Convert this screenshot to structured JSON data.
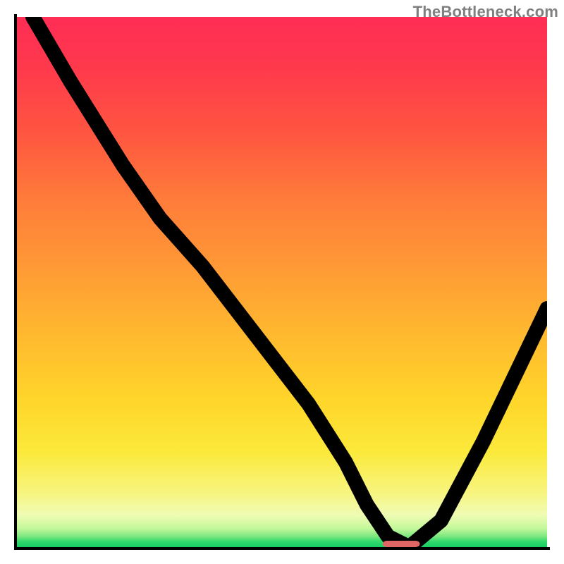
{
  "watermark": "TheBottleneck.com",
  "chart_data": {
    "type": "line",
    "title": "",
    "xlabel": "",
    "ylabel": "",
    "xlim": [
      0,
      100
    ],
    "ylim": [
      0,
      100
    ],
    "grid": false,
    "legend": null,
    "background": "red-to-green vertical gradient",
    "series": [
      {
        "name": "bottleneck-curve",
        "x": [
          3,
          10,
          20,
          27,
          35,
          45,
          55,
          62,
          66,
          70,
          74,
          80,
          88,
          100
        ],
        "y": [
          100,
          88,
          72,
          62,
          53,
          40,
          27,
          16,
          8,
          2,
          0,
          5,
          20,
          45
        ]
      }
    ],
    "marker": {
      "name": "optimal-range",
      "x_start": 69,
      "x_end": 76,
      "y": 0,
      "height": 1.2
    }
  }
}
